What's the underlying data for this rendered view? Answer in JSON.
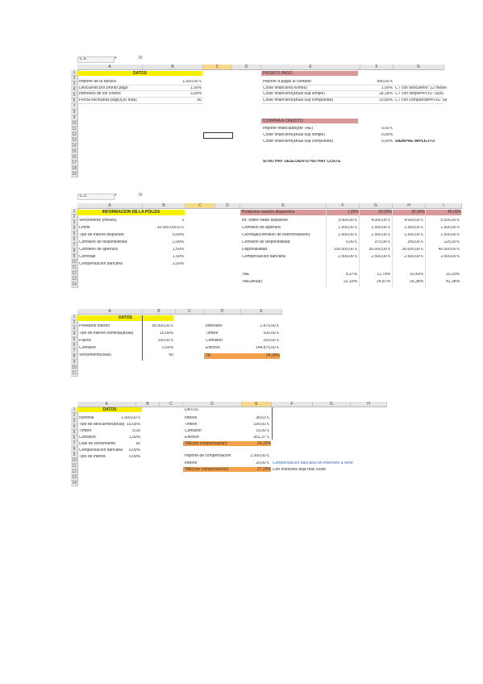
{
  "s1": {
    "namebox": "C 6",
    "cols": [
      "A",
      "B",
      "C",
      "D",
      "E",
      "F",
      "G"
    ],
    "datos_header": "DATOS",
    "rows": [
      {
        "label": "Importe de la factura",
        "value": "1.000,00 €"
      },
      {
        "label": "Descuento por pronto pago",
        "value": "1,00%"
      },
      {
        "label": "Intereses de los cobros",
        "value": "3,00%"
      },
      {
        "label": "Fecha inicio(días pago)(30 días)",
        "value": "60"
      }
    ],
    "right_header": "PRONTO PAGO",
    "right_rows": [
      {
        "label": "Importe a pagar al contado",
        "value": "990,00 €",
        "note": ""
      },
      {
        "label": "Coste financiero(%/mes)",
        "value": "1,00%",
        "note": "CT con descuento: 12 meses"
      },
      {
        "label": "Coste financiero(anual sup simple)",
        "value": "18,18%",
        "note": "CT con simple=POS- SI(A)"
      },
      {
        "label": "Coste financiero(anual sup compuesta)",
        "value": "19,85%",
        "note": "CT con compuesta=POS- SI(A)"
      }
    ],
    "second_header": "COMPRA A CRÉDITO",
    "second_rows": [
      {
        "label": "Importe financiado(pte TAE)",
        "value": "0,00 €",
        "note": ""
      },
      {
        "label": "Coste financiero(anual sup simple)",
        "value": "0,00%",
        "note": ""
      },
      {
        "label": "Coste financiero(anual sup compuesta)",
        "value": "0,00%",
        "note": "SIEMPRE IMPLÍCITO"
      }
    ],
    "footer": "SI NO HAY DESCUENTO NO HAY COSTE"
  },
  "s2": {
    "namebox": "C 2",
    "cols": [
      "A",
      "B",
      "C",
      "D",
      "E",
      "F",
      "G",
      "H",
      "I"
    ],
    "info_header": "INFORMACIÓN DE LA PÓLIZA",
    "rows": [
      {
        "label": "Vencimiento (meses)",
        "value": "3"
      },
      {
        "label": "Límite",
        "value": "10.000.000,0 €"
      },
      {
        "label": "Tipo de interés dispuesto",
        "value": "5,00%"
      },
      {
        "label": "Comisión de disponibilidad",
        "value": "2,00%"
      },
      {
        "label": "Comisión de apertura",
        "value": "1,50%"
      },
      {
        "label": "Corretaje",
        "value": "1,50%"
      },
      {
        "label": "Compensación bancaria",
        "value": "2,00%"
      }
    ],
    "right_header": "Productos usados dispuestos",
    "right_header_values": [
      "1,00%",
      "20,00%",
      "30,00%",
      "40,00%"
    ],
    "right_rows": [
      {
        "label": "Int. sobre saldo dispuesto",
        "values": [
          "3.000,00 €",
          "4.000,00 €",
          "4.000,00 €",
          "5.000,00 €"
        ]
      },
      {
        "label": "Comisión de apertura",
        "values": [
          "1.500,00 €",
          "1.500,00 €",
          "1.500,00 €",
          "1.500,00 €"
        ]
      },
      {
        "label": "Corretaje(comisión de intermediación)",
        "values": [
          "1.500,00 €",
          "1.500,00 €",
          "1.500,00 €",
          "1.500,00 €"
        ]
      },
      {
        "label": "Comisión de disponibilidad",
        "values": [
          "0,00 €",
          "375,00 €",
          "250,00 €",
          "125,00 €"
        ]
      },
      {
        "label": "Disponibilidad",
        "values": [
          "100.000,00 €",
          "30.000,00 €",
          "30.000,00 €",
          "40.000,00 €"
        ]
      },
      {
        "label": "Compensación bancaria",
        "values": [
          "2.500,00 €",
          "2.500,00 €",
          "2.500,00 €",
          "2.500,00 €"
        ]
      }
    ],
    "tae": {
      "label": "TAE",
      "values": [
        "8,37%",
        "11,79%",
        "10,43%",
        "10,20%"
      ]
    },
    "tae2": {
      "label": "TAE(anual)",
      "values": [
        "22,10%",
        "24,87%",
        "26,38%",
        "42,38%"
      ]
    }
  },
  "s3": {
    "cols": [
      "A",
      "B",
      "C",
      "D",
      "E"
    ],
    "datos_header": "DATOS",
    "rows": [
      {
        "label": "Préstamo interno",
        "value": "50.000,00 €"
      },
      {
        "label": "Tipo de interés nominal(anual)",
        "value": "15,00%"
      },
      {
        "label": "Plazos",
        "value": "100,00 €"
      },
      {
        "label": "Comisión",
        "value": "0,50%"
      },
      {
        "label": "Vencimiento(días)",
        "value": "60"
      }
    ],
    "right_rows": [
      {
        "label": "Intereses",
        "value": "1.875,00 €"
      },
      {
        "label": "Timbre",
        "value": "100,00 €"
      },
      {
        "label": "Comisión",
        "value": "250,00 €"
      },
      {
        "label": "Efectivo",
        "value": "144.875,00 €"
      }
    ],
    "tae": {
      "label": "TE",
      "value": "24,33%"
    }
  },
  "s4": {
    "cols": [
      "A",
      "B",
      "C",
      "D",
      "E",
      "F",
      "G",
      "H"
    ],
    "datos_header": "DATOS",
    "rows": [
      {
        "label": "Nominal",
        "value": "1.000,00 €"
      },
      {
        "label": "Tipo de descuento(anual)",
        "value": "15,65%"
      },
      {
        "label": "Timbre",
        "value": "5,00"
      },
      {
        "label": "Comisión",
        "value": "1,50%"
      },
      {
        "label": "Días de vencimiento",
        "value": "90"
      },
      {
        "label": "Compensación bancaria",
        "value": "0,00%"
      },
      {
        "label": "Tipo de interés",
        "value": "0,00%"
      }
    ],
    "right_header": "DATOS",
    "right_rows": [
      {
        "label": "Interés",
        "value": "38,63 €"
      },
      {
        "label": "Timbre",
        "value": "100,00 €"
      },
      {
        "label": "Comisión",
        "value": "15,00 €"
      },
      {
        "label": "Efectivo",
        "value": "951,37 €"
      }
    ],
    "tae1": {
      "label": "TAE(sin compensación)",
      "value": "24,33%"
    },
    "comp_rows": [
      {
        "label": "Importe de compensación",
        "value": "1.000,00 €",
        "note": ""
      },
      {
        "label": "Interés",
        "value": "20,00 €",
        "note": "Compensación bancaria sin intereses a favor"
      }
    ],
    "tae2": {
      "label": "TAE(con compensación)",
      "value": "27,20%",
      "note": "Con intereses deja más coste"
    }
  }
}
